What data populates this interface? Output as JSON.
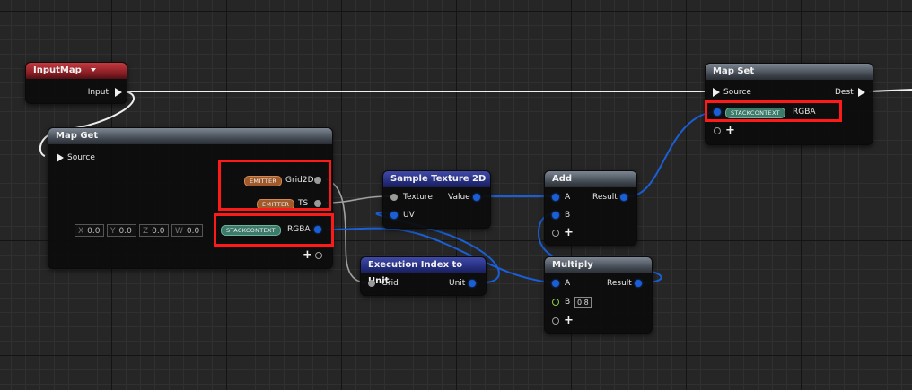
{
  "nodes": {
    "input_map": {
      "title": "InputMap",
      "output_label": "Input"
    },
    "map_get": {
      "title": "Map Get",
      "source_label": "Source",
      "outputs": [
        {
          "badge": "EMITTER",
          "label": "Grid2D"
        },
        {
          "badge": "EMITTER",
          "label": "TS"
        },
        {
          "badge": "STACKCONTEXT",
          "label": "RGBA"
        }
      ],
      "default_fields": [
        {
          "axis": "X",
          "value": "0.0"
        },
        {
          "axis": "Y",
          "value": "0.0"
        },
        {
          "axis": "Z",
          "value": "0.0"
        },
        {
          "axis": "W",
          "value": "0.0"
        }
      ]
    },
    "sample_texture": {
      "title": "Sample Texture 2D",
      "in_texture": "Texture",
      "in_uv": "UV",
      "out_value": "Value"
    },
    "exec_index": {
      "title": "Execution Index to Unit",
      "in_grid": "Grid",
      "out_unit": "Unit"
    },
    "add": {
      "title": "Add",
      "in_a": "A",
      "in_b": "B",
      "out_result": "Result"
    },
    "multiply": {
      "title": "Multiply",
      "in_a": "A",
      "in_b": "B",
      "b_value": "0.8",
      "out_result": "Result"
    },
    "map_set": {
      "title": "Map Set",
      "source_label": "Source",
      "dest_label": "Dest",
      "badge": "STACKCONTEXT",
      "pin_label": "RGBA"
    }
  },
  "colors": {
    "wire_exec": "#f0f0f0",
    "wire_float": "#1a5fd6",
    "wire_object": "#9a9a9a",
    "highlight": "#ff1a1a"
  }
}
